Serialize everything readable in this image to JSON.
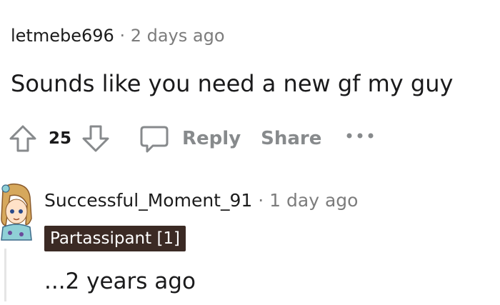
{
  "comment1": {
    "username": "letmebe696",
    "separator": "·",
    "timestamp": "2 days ago",
    "body": "Sounds like you need a new gf my guy",
    "score": "25",
    "reply_label": "Reply",
    "share_label": "Share",
    "more_label": "•••"
  },
  "comment2": {
    "username": "Successful_Moment_91",
    "separator": "·",
    "timestamp": "1 day ago",
    "flair": "Partassipant [1]",
    "body": "...2 years ago"
  },
  "colors": {
    "muted": "#878a8c",
    "flair_bg": "#3b2a24",
    "thread_line": "#e5e5e5"
  },
  "icons": [
    "upvote-icon",
    "downvote-icon",
    "comment-bubble-icon",
    "more-options-icon",
    "avatar-icon"
  ]
}
